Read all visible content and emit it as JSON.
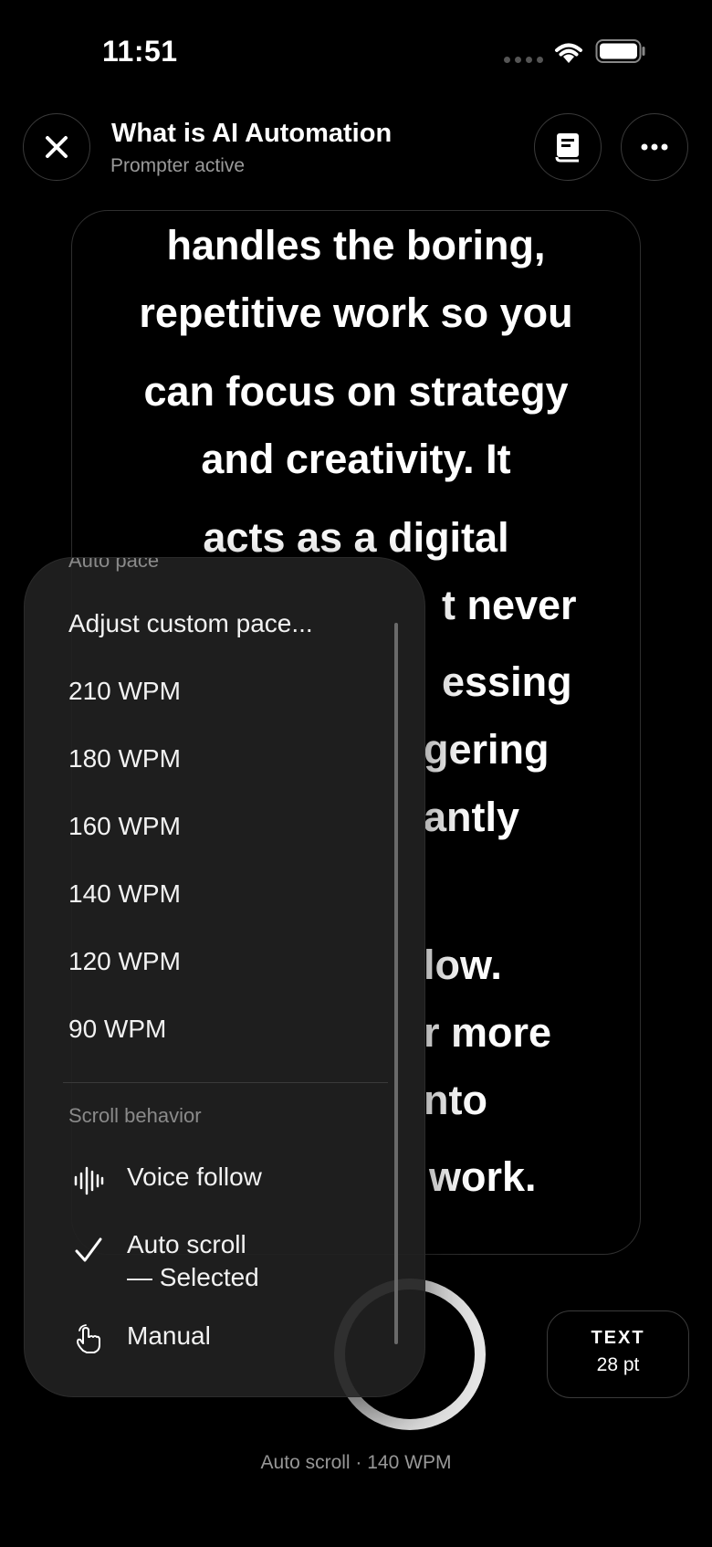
{
  "status_bar": {
    "time": "11:51"
  },
  "header": {
    "title": "What is AI Automation",
    "subtitle": "Prompter active"
  },
  "prompter": {
    "lines": [
      "handles the boring,",
      "repetitive work so you",
      "can focus on strategy",
      "and creativity. It",
      "acts as a digital",
      "t never",
      "essing",
      "gering",
      "antly",
      "low.",
      "r more",
      "nto",
      "work."
    ]
  },
  "pace_menu": {
    "auto_pace_label": "Auto pace",
    "custom_pace_label": "Adjust custom pace...",
    "pace_options": [
      "210 WPM",
      "180 WPM",
      "160 WPM",
      "140 WPM",
      "120 WPM",
      "90 WPM"
    ],
    "scroll_behavior_label": "Scroll behavior",
    "voice_follow_label": "Voice follow",
    "auto_scroll_label": "Auto scroll",
    "auto_scroll_selected": "— Selected",
    "manual_label": "Manual"
  },
  "controls": {
    "text_size_label": "TEXT",
    "text_size_value": "28 pt",
    "status": "Auto scroll · 140 WPM"
  },
  "colors": {
    "background": "#000000",
    "menu_background": "#202020",
    "secondary_text": "#9a9a9a"
  }
}
